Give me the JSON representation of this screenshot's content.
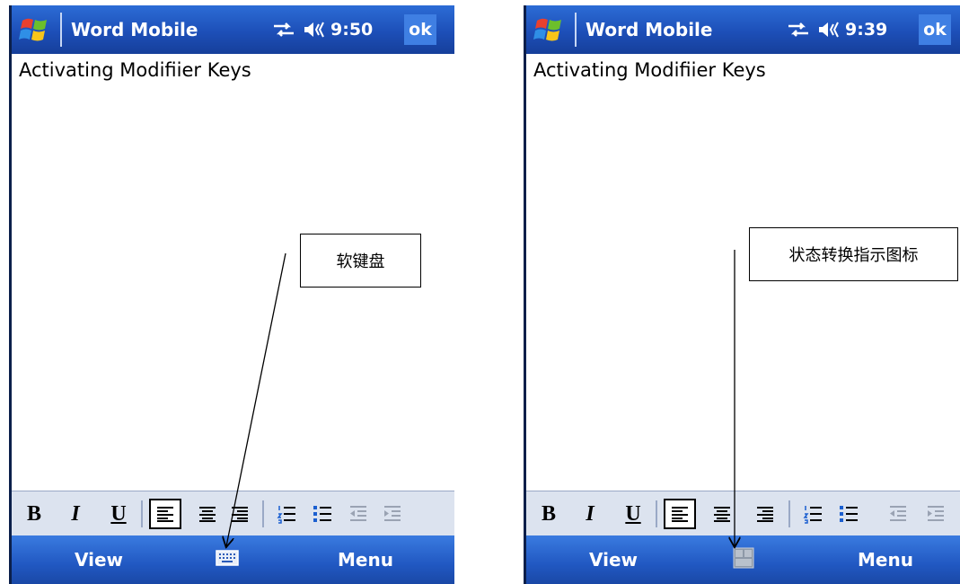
{
  "screens": [
    {
      "app_title": "Word Mobile",
      "time": "9:50",
      "ok_label": "ok",
      "document_text": "Activating Modifiier Keys",
      "toolbar": {
        "bold": "B",
        "italic": "I",
        "underline": "U"
      },
      "softkeys": {
        "left": "View",
        "right": "Menu",
        "center_icon": "keyboard-icon"
      }
    },
    {
      "app_title": "Word Mobile",
      "time": "9:39",
      "ok_label": "ok",
      "document_text": "Activating Modifiier Keys",
      "toolbar": {
        "bold": "B",
        "italic": "I",
        "underline": "U"
      },
      "softkeys": {
        "left": "View",
        "right": "Menu",
        "center_icon": "input-status-icon"
      }
    }
  ],
  "annotations": {
    "left": "软键盘",
    "right": "状态转换指示图标"
  },
  "colors": {
    "titlebar": "#1d4fb8",
    "toolbar": "#dce3ef",
    "softbar": "#2158c2"
  }
}
